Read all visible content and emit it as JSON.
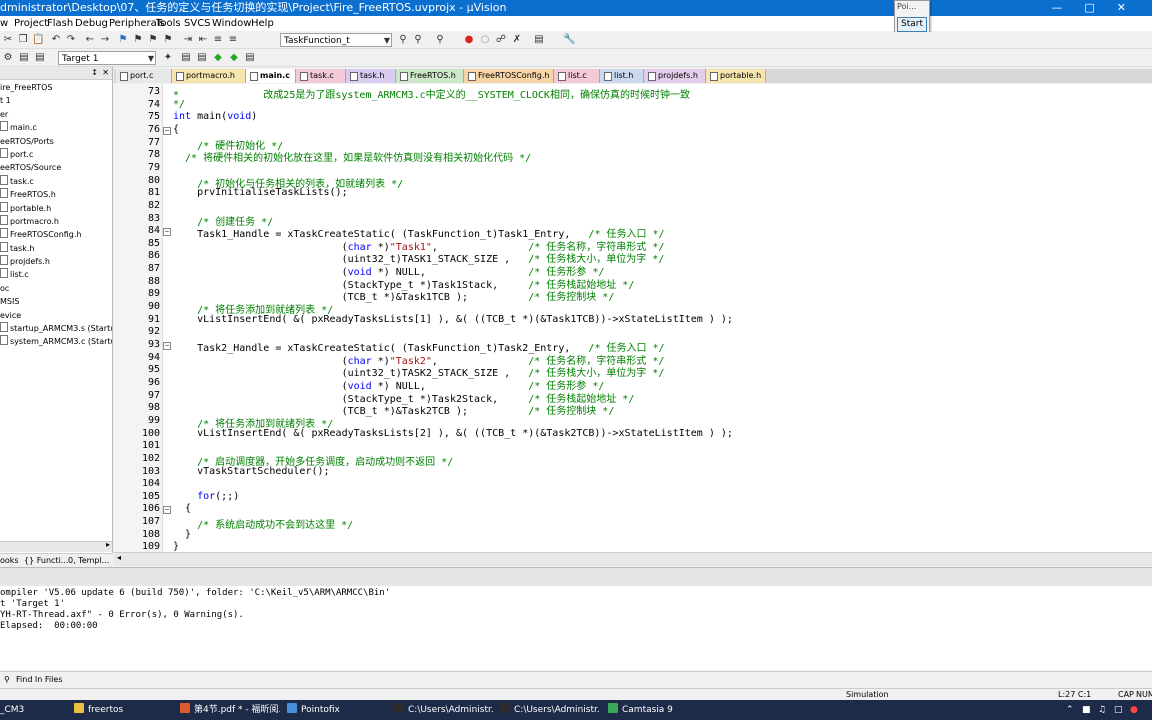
{
  "window": {
    "title": "dministrator\\Desktop\\07、任务的定义与任务切换的实现\\Project\\Fire_FreeRTOS.uvprojx - µVision"
  },
  "popup": {
    "title": "Poi...",
    "button": "Start"
  },
  "menu": [
    "w",
    "Project",
    "Flash",
    "Debug",
    "Peripherals",
    "Tools",
    "SVCS",
    "Window",
    "Help"
  ],
  "toolbar": {
    "function_combo": "TaskFunction_t",
    "target_combo": "Target 1"
  },
  "project_tree": [
    "ire_FreeRTOS",
    "t 1",
    "er",
    "main.c",
    "eeRTOS/Ports",
    "port.c",
    "eeRTOS/Source",
    "task.c",
    "FreeRTOS.h",
    "portable.h",
    "portmacro.h",
    "FreeRTOSConfig.h",
    "task.h",
    "projdefs.h",
    "list.c",
    "oc",
    "MSIS",
    "evice",
    "startup_ARMCM3.s (Startup)",
    "system_ARMCM3.c (Startup)"
  ],
  "left_tabs": [
    "ooks",
    "{} Functi...",
    "0, Templ..."
  ],
  "tabs": [
    {
      "label": "port.c",
      "color": "#e8e8e8"
    },
    {
      "label": "portmacro.h",
      "color": "#f5e6b0"
    },
    {
      "label": "main.c",
      "color": "#ffffff",
      "active": true
    },
    {
      "label": "task.c",
      "color": "#f3c9d8"
    },
    {
      "label": "task.h",
      "color": "#d8cdf0"
    },
    {
      "label": "FreeRTOS.h",
      "color": "#cde8c8"
    },
    {
      "label": "FreeRTOSConfig.h",
      "color": "#f6d4a8"
    },
    {
      "label": "list.c",
      "color": "#f3c9d8"
    },
    {
      "label": "list.h",
      "color": "#cbd9f0"
    },
    {
      "label": "projdefs.h",
      "color": "#e4cdea"
    },
    {
      "label": "portable.h",
      "color": "#f5e6b0"
    }
  ],
  "code": [
    {
      "n": "73",
      "t": "*              改成25是为了跟system_ARMCM3.c中定义的__SYSTEM_CLOCK相同，确保仿真的时候时钟一致",
      "cls": "cm"
    },
    {
      "n": "74",
      "t": "*/",
      "cls": "cm"
    },
    {
      "n": "75",
      "t": "int main(void)",
      "cls": ""
    },
    {
      "n": "76",
      "t": "{",
      "cls": "",
      "fold": true
    },
    {
      "n": "77",
      "t": "    /* 硬件初始化 */",
      "cls": "cm"
    },
    {
      "n": "78",
      "t": "  /* 将硬件相关的初始化放在这里，如果是软件仿真则没有相关初始化代码 */",
      "cls": "cm"
    },
    {
      "n": "79",
      "t": "",
      "cls": ""
    },
    {
      "n": "80",
      "t": "    /* 初始化与任务相关的列表，如就绪列表 */",
      "cls": "cm"
    },
    {
      "n": "81",
      "t": "    prvInitialiseTaskLists();",
      "cls": ""
    },
    {
      "n": "82",
      "t": "",
      "cls": ""
    },
    {
      "n": "83",
      "t": "    /* 创建任务 */",
      "cls": "cm"
    },
    {
      "n": "84",
      "t": "    Task1_Handle = xTaskCreateStatic( (TaskFunction_t)Task1_Entry,   /* 任务入口 */",
      "cls": "",
      "fold": true
    },
    {
      "n": "85",
      "t": "                            (char *)\"Task1\",               /* 任务名称，字符串形式 */",
      "cls": ""
    },
    {
      "n": "86",
      "t": "                            (uint32_t)TASK1_STACK_SIZE ,   /* 任务栈大小，单位为字 */",
      "cls": ""
    },
    {
      "n": "87",
      "t": "                            (void *) NULL,                 /* 任务形参 */",
      "cls": ""
    },
    {
      "n": "88",
      "t": "                            (StackType_t *)Task1Stack,     /* 任务栈起始地址 */",
      "cls": ""
    },
    {
      "n": "89",
      "t": "                            (TCB_t *)&Task1TCB );          /* 任务控制块 */",
      "cls": ""
    },
    {
      "n": "90",
      "t": "    /* 将任务添加到就绪列表 */",
      "cls": "cm"
    },
    {
      "n": "91",
      "t": "    vListInsertEnd( &( pxReadyTasksLists[1] ), &( ((TCB_t *)(&Task1TCB))->xStateListItem ) );",
      "cls": ""
    },
    {
      "n": "92",
      "t": "",
      "cls": ""
    },
    {
      "n": "93",
      "t": "    Task2_Handle = xTaskCreateStatic( (TaskFunction_t)Task2_Entry,   /* 任务入口 */",
      "cls": "",
      "fold": true
    },
    {
      "n": "94",
      "t": "                            (char *)\"Task2\",               /* 任务名称，字符串形式 */",
      "cls": ""
    },
    {
      "n": "95",
      "t": "                            (uint32_t)TASK2_STACK_SIZE ,   /* 任务栈大小，单位为字 */",
      "cls": ""
    },
    {
      "n": "96",
      "t": "                            (void *) NULL,                 /* 任务形参 */",
      "cls": ""
    },
    {
      "n": "97",
      "t": "                            (StackType_t *)Task2Stack,     /* 任务栈起始地址 */",
      "cls": ""
    },
    {
      "n": "98",
      "t": "                            (TCB_t *)&Task2TCB );          /* 任务控制块 */",
      "cls": ""
    },
    {
      "n": "99",
      "t": "    /* 将任务添加到就绪列表 */",
      "cls": "cm"
    },
    {
      "n": "100",
      "t": "    vListInsertEnd( &( pxReadyTasksLists[2] ), &( ((TCB_t *)(&Task2TCB))->xStateListItem ) );",
      "cls": ""
    },
    {
      "n": "101",
      "t": "",
      "cls": ""
    },
    {
      "n": "102",
      "t": "    /* 启动调度器，开始多任务调度，启动成功则不返回 */",
      "cls": "cm"
    },
    {
      "n": "103",
      "t": "    vTaskStartScheduler();",
      "cls": ""
    },
    {
      "n": "104",
      "t": "",
      "cls": ""
    },
    {
      "n": "105",
      "t": "    for(;;)",
      "cls": ""
    },
    {
      "n": "106",
      "t": "  {",
      "cls": "",
      "fold": true
    },
    {
      "n": "107",
      "t": "    /* 系统启动成功不会到达这里 */",
      "cls": "cm"
    },
    {
      "n": "108",
      "t": "  }",
      "cls": ""
    },
    {
      "n": "109",
      "t": "}",
      "cls": ""
    }
  ],
  "build_output": [
    "ompiler 'V5.06 update 6 (build 750)', folder: 'C:\\Keil_v5\\ARM\\ARMCC\\Bin'",
    "t 'Target 1'",
    "YH-RT-Thread.axf\" - 0 Error(s), 0 Warning(s).",
    "Elapsed:  00:00:00"
  ],
  "find_tab": "Find In Files",
  "status": {
    "mode": "Simulation",
    "pos": "L:27 C:1",
    "caps": "CAP",
    "num": "NUM"
  },
  "taskbar": [
    {
      "label": "_CM3",
      "color": "#3a6fd8"
    },
    {
      "label": "freertos",
      "color": "#e8c042"
    },
    {
      "label": "第4节.pdf * - 福昕阅...",
      "color": "#e05a2b"
    },
    {
      "label": "Pointofix",
      "color": "#4a90d9"
    },
    {
      "label": "C:\\Users\\Administr...",
      "color": "#2c2c2c"
    },
    {
      "label": "C:\\Users\\Administr...",
      "color": "#2c2c2c"
    },
    {
      "label": "Camtasia 9",
      "color": "#3aa757"
    }
  ]
}
